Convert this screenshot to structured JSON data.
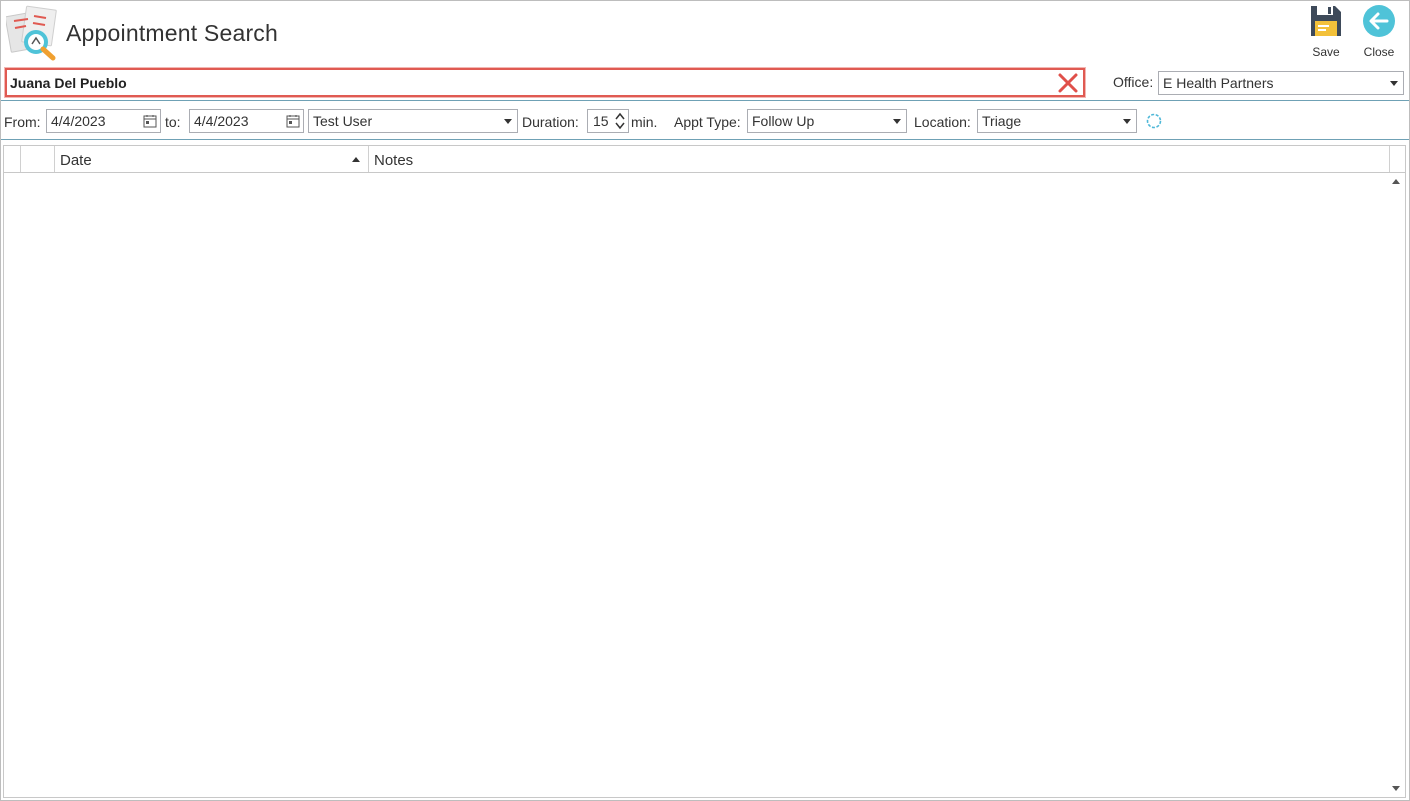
{
  "header": {
    "title": "Appointment Search",
    "save_label": "Save",
    "close_label": "Close"
  },
  "search": {
    "value": "Juana Del Pueblo"
  },
  "office": {
    "label": "Office:",
    "value": "E Health Partners"
  },
  "filters": {
    "from_label": "From:",
    "from_value": "4/4/2023",
    "to_label": "to:",
    "to_value": "4/4/2023",
    "provider_value": "Test User",
    "duration_label": "Duration:",
    "duration_value": "15",
    "duration_unit": "min.",
    "appt_type_label": "Appt Type:",
    "appt_type_value": "Follow Up",
    "location_label": "Location:",
    "location_value": "Triage"
  },
  "grid": {
    "columns": [
      "",
      "Date",
      "Notes"
    ],
    "sort": "ascending",
    "rows": []
  },
  "colors": {
    "accent": "#4fc3d8",
    "highlight_border": "#e05a52",
    "clear_icon": "#e0504a"
  }
}
